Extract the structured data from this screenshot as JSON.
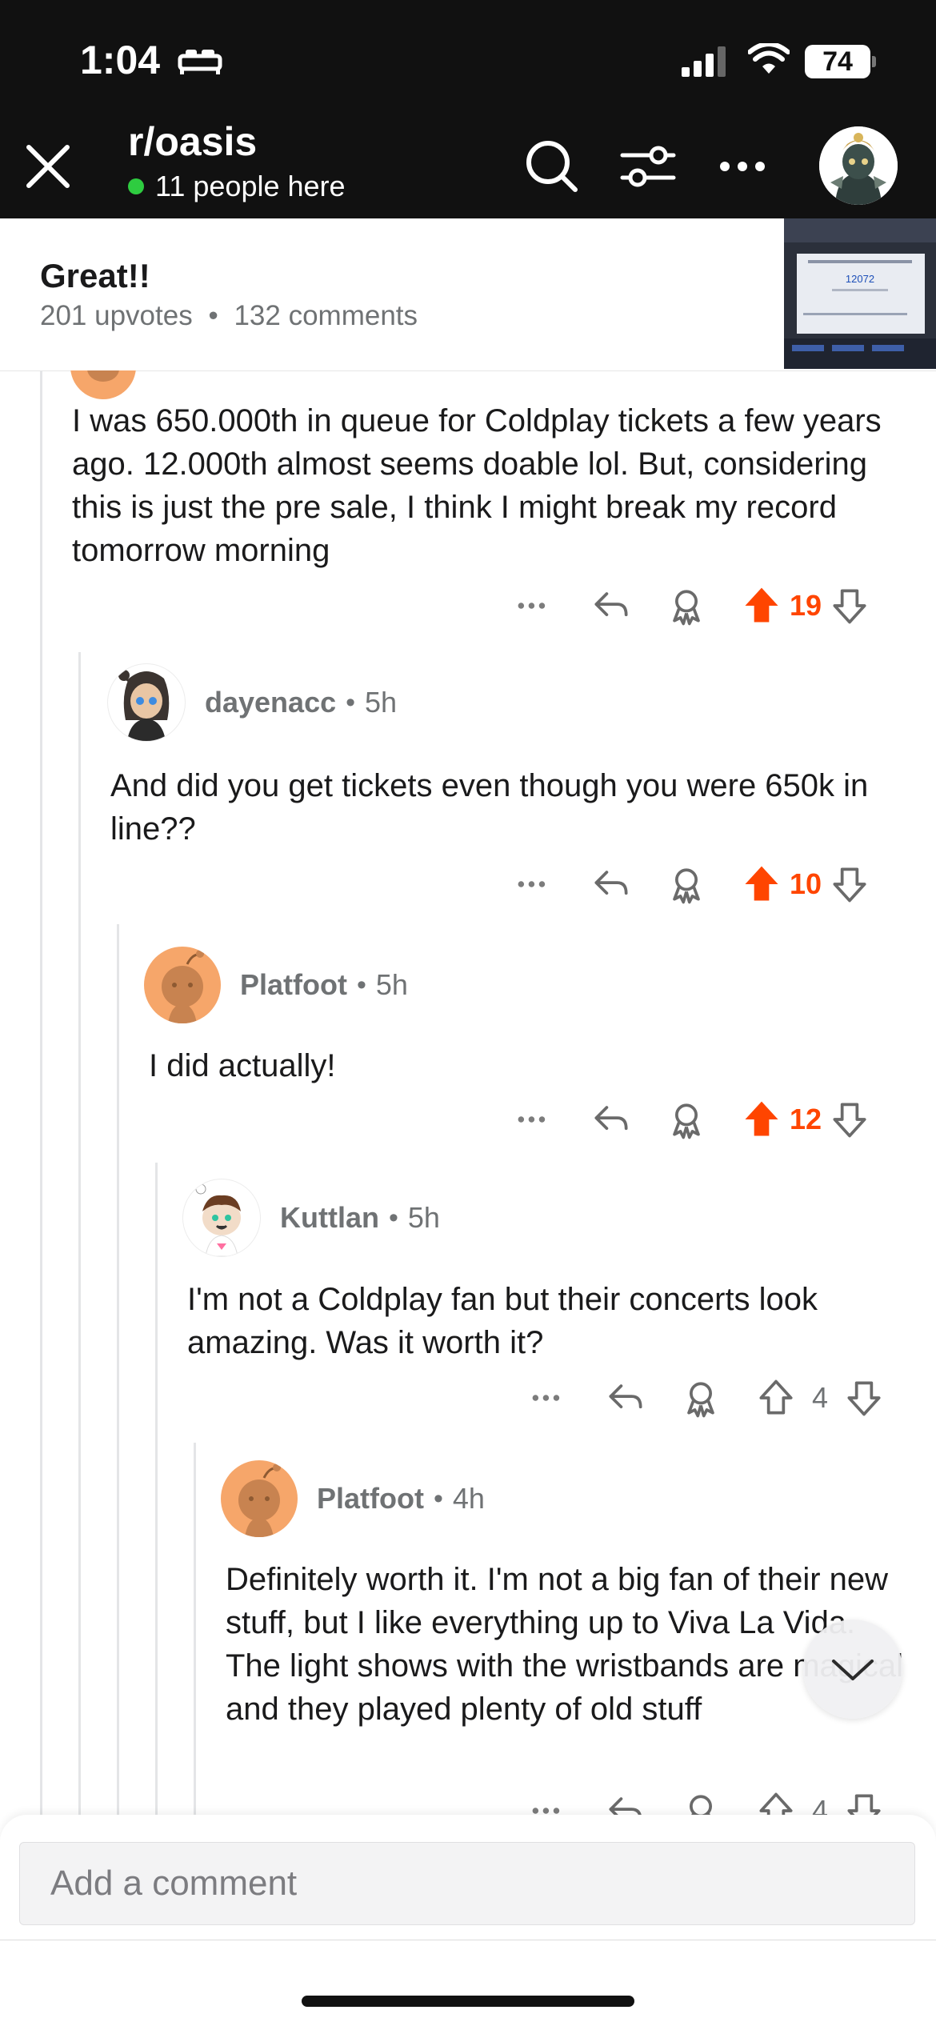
{
  "status_bar": {
    "time": "1:04",
    "battery": "74"
  },
  "header": {
    "subreddit": "r/oasis",
    "online_text": "11 people here"
  },
  "post": {
    "title": "Great!!",
    "upvotes": "201 upvotes",
    "separator": "•",
    "comments": "132 comments",
    "thumbnail_text": "12072"
  },
  "comments": [
    {
      "text": "I was 650.000th in queue for Coldplay tickets a few years ago. 12.000th almost seems doable lol. But, considering this is just the pre sale, I think I might break my record tomorrow morning",
      "votes": "19",
      "upvoted": true
    },
    {
      "user": "dayenacc",
      "age": "5h",
      "text": "And did you get tickets even though you were 650k in line??",
      "votes": "10",
      "upvoted": true
    },
    {
      "user": "Platfoot",
      "age": "5h",
      "text": "I did actually!",
      "votes": "12",
      "upvoted": true
    },
    {
      "user": "Kuttlan",
      "age": "5h",
      "text": "I'm not a Coldplay fan but their concerts look amazing. Was it worth it?",
      "votes": "4",
      "upvoted": false
    },
    {
      "user": "Platfoot",
      "age": "4h",
      "text": "Definitely worth it. I'm not a big fan of their new stuff, but I like everything up to Viva La Vida. The light shows with the wristbands are magical and they played plenty of old stuff",
      "votes": "4",
      "upvoted": false
    }
  ],
  "composer": {
    "placeholder": "Add a comment"
  },
  "colors": {
    "upvote": "#ff4500",
    "header_bg": "#111111",
    "online": "#2ecc40"
  },
  "icons": [
    "close-icon",
    "search-icon",
    "filter-icon",
    "more-icon",
    "reply-icon",
    "award-icon",
    "upvote-icon",
    "downvote-icon",
    "chevron-down-icon"
  ]
}
